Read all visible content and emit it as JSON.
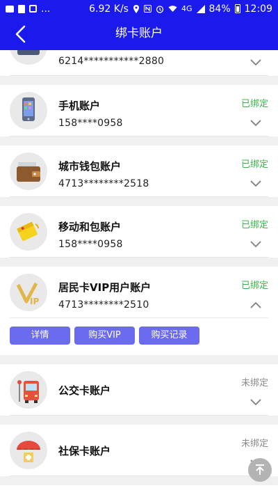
{
  "status_bar": {
    "network_speed": "6.92 K/s",
    "network_type": "4G",
    "battery": "84%",
    "time": "12:09",
    "left_icons": [
      "image-icon",
      "document-icon",
      "s-app-icon"
    ],
    "left_dots": "...",
    "right_icons": [
      "location-icon",
      "nfc-icon",
      "alarm-icon",
      "wifi-icon",
      "signal-icon",
      "battery-icon"
    ]
  },
  "header": {
    "title": "绑卡账户",
    "back_icon": "back-arrow-icon",
    "bg_color": "#1a1aec"
  },
  "accounts": [
    {
      "name": "",
      "number": "6214***********2880",
      "status": "",
      "icon": "bank-card-icon",
      "expanded": false
    },
    {
      "name": "手机账户",
      "number": "158****0958",
      "status": "已绑定",
      "icon": "phone-icon",
      "expanded": false
    },
    {
      "name": "城市钱包账户",
      "number": "4713********2518",
      "status": "已绑定",
      "icon": "wallet-icon",
      "expanded": false
    },
    {
      "name": "移动和包账户",
      "number": "158****0958",
      "status": "已绑定",
      "icon": "hebao-wallet-icon",
      "expanded": false
    },
    {
      "name": "居民卡VIP用户账户",
      "number": "4713********2510",
      "status": "已绑定",
      "icon": "vip-icon",
      "expanded": true
    },
    {
      "name": "公交卡账户",
      "number": "",
      "status": "未绑定",
      "icon": "bus-icon",
      "expanded": false
    },
    {
      "name": "社保卡账户",
      "number": "",
      "status": "未绑定",
      "icon": "umbrella-icon",
      "expanded": false
    }
  ],
  "vip_actions": {
    "details": "详情",
    "buy_vip": "购买VIP",
    "purchase_history": "购买记录"
  },
  "colors": {
    "bound": "#3ab54a",
    "unbound": "#8a8a8a",
    "action_button": "#6b6bf0"
  },
  "scroll_top_icon": "scroll-to-top-icon"
}
